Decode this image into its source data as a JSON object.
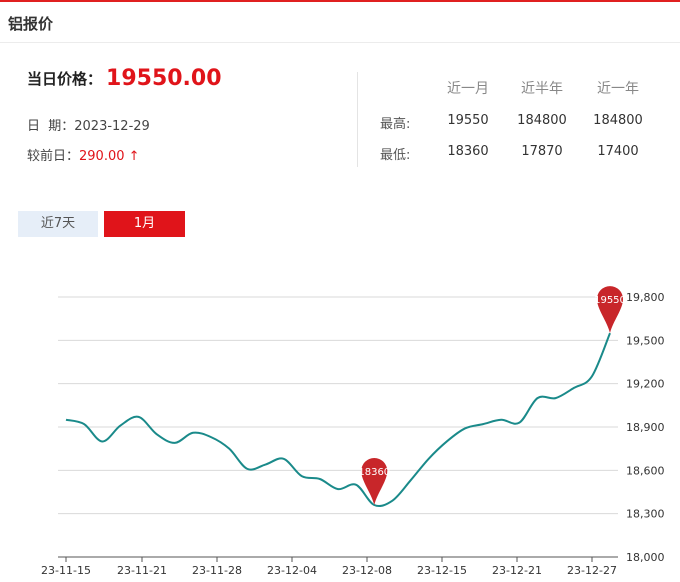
{
  "header": {
    "title": "铝报价"
  },
  "summary": {
    "price_label": "当日价格：",
    "price_value": "19550.00",
    "date_label": "日  期：",
    "date_value": "2023-12-29",
    "change_label": "较前日：",
    "change_value": "290.00 ↑"
  },
  "stats": {
    "headers": [
      "近一月",
      "近半年",
      "近一年"
    ],
    "rows": [
      {
        "label": "最高:",
        "values": [
          "19550",
          "184800",
          "184800"
        ]
      },
      {
        "label": "最低:",
        "values": [
          "18360",
          "17870",
          "17400"
        ]
      }
    ]
  },
  "tabs": [
    {
      "label": "近7天",
      "active": false
    },
    {
      "label": "1月",
      "active": true
    }
  ],
  "colors": {
    "accent": "#e0141a",
    "line": "#1a8a8a",
    "marker": "#c8262a",
    "grid": "#d9d9d9"
  },
  "chart_data": {
    "type": "line",
    "x_tick_labels": [
      "23-11-15",
      "23-11-21",
      "23-11-28",
      "23-12-04",
      "23-12-08",
      "23-12-15",
      "23-12-21",
      "23-12-27"
    ],
    "y_tick_labels": [
      "19,800",
      "19,500",
      "19,200",
      "18,900",
      "18,600",
      "18,300",
      "18,000"
    ],
    "y_ticks": [
      19800,
      19500,
      19200,
      18900,
      18600,
      18300,
      18000
    ],
    "ylim": [
      18000,
      19800
    ],
    "grid": true,
    "series": [
      {
        "values": [
          18950,
          18920,
          18800,
          18910,
          18970,
          18850,
          18790,
          18860,
          18830,
          18750,
          18610,
          18640,
          18680,
          18560,
          18540,
          18470,
          18500,
          18360,
          18390,
          18530,
          18680,
          18800,
          18890,
          18920,
          18950,
          18930,
          19100,
          19100,
          19170,
          19250,
          19550
        ]
      }
    ],
    "annotations": [
      {
        "label": "18360",
        "index": 17
      },
      {
        "label": "19550",
        "index": 30
      }
    ]
  }
}
